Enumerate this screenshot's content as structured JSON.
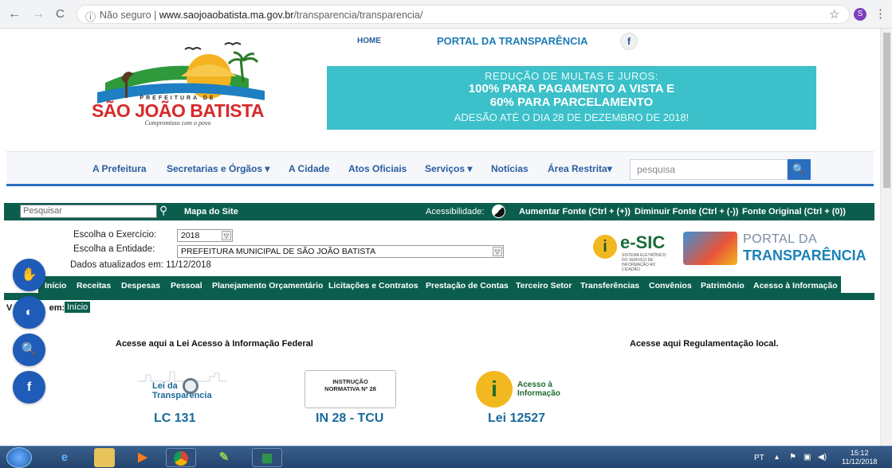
{
  "browser": {
    "security_label": "Não seguro",
    "url_domain": "www.saojoaobatista.ma.gov.br",
    "url_path": "/transparencia/transparencia/",
    "profile_initial": "S"
  },
  "header": {
    "logo_small": "PREFEITURA DE",
    "logo_name": "SÃO JOÃO BATISTA",
    "logo_tagline": "Compromisso com o povo",
    "home_link": "HOME",
    "portal_link": "PORTAL DA TRANSPARÊNCIA",
    "facebook_icon": "f"
  },
  "banner": {
    "line1": "REDUÇÃO DE MULTAS E JUROS:",
    "line2": "100% PARA PAGAMENTO A VISTA E",
    "line3": "60% PARA PARCELAMENTO",
    "line4": "ADESÃO ATÉ O DIA 28 DE DEZEMBRO DE 2018!"
  },
  "main_menu": {
    "items": [
      "A Prefeitura",
      "Secretarias e Órgãos ▾",
      "A Cidade",
      "Atos Oficiais",
      "Serviços ▾",
      "Notícias",
      "Área Restrita▾"
    ],
    "search_placeholder": "pesquisa"
  },
  "accessibility_bar": {
    "search_placeholder": "Pesquisar",
    "site_map": "Mapa do Site",
    "accessibility_label": "Acessibilidade:",
    "increase_font": "Aumentar Fonte (Ctrl + (+))",
    "decrease_font": "Diminuir Fonte (Ctrl + (-))",
    "original_font": "Fonte Original (Ctrl + (0))"
  },
  "filters": {
    "year_label": "Escolha o Exercício:",
    "year_value": "2018",
    "entity_label": "Escolha a Entidade:",
    "entity_value": "PREFEITURA MUNICIPAL DE SÃO JOÃO BATISTA",
    "updated_text": "Dados atualizados em: 11/12/2018"
  },
  "esic": {
    "name": "e-SIC",
    "subtitle": "SISTEMA ELETRÔNICO DO SERVIÇO DE INFORMAÇÃO AO CIDADÃO"
  },
  "portal_logo": {
    "line1": "PORTAL DA",
    "line2": "TRANSPARÊNCIA"
  },
  "tab_menu": {
    "items": [
      "Início",
      "Receitas",
      "Despesas",
      "Pessoal",
      "Planejamento Orçamentário",
      "Licitações e Contratos",
      "Prestação de Contas",
      "Terceiro Setor",
      "Transferências",
      "Convênios",
      "Patrimônio",
      "Acesso à Informação"
    ]
  },
  "breadcrumb": {
    "label": "Você está em:",
    "visible_label": "em:",
    "home": "Início"
  },
  "content": {
    "federal_heading": "Acesse aqui a Lei Acesso à Informação Federal",
    "local_heading": "Acesse aqui Regulamentação local.",
    "cards": [
      {
        "logo_text": "Lei da Transparência",
        "title": "LC 131"
      },
      {
        "logo_text": "INSTRUÇÃO NORMATIVA Nº 28",
        "title": "IN 28 - TCU"
      },
      {
        "logo_text": "Acesso à Informação",
        "title": "Lei 12527"
      }
    ]
  },
  "floating_buttons": {
    "accessibility_icon": "✋",
    "contrast_icon": "◐",
    "zoom_icon": "🔍",
    "facebook_icon": "f"
  },
  "taskbar": {
    "language": "PT",
    "time": "15:12",
    "date": "11/12/2018"
  }
}
